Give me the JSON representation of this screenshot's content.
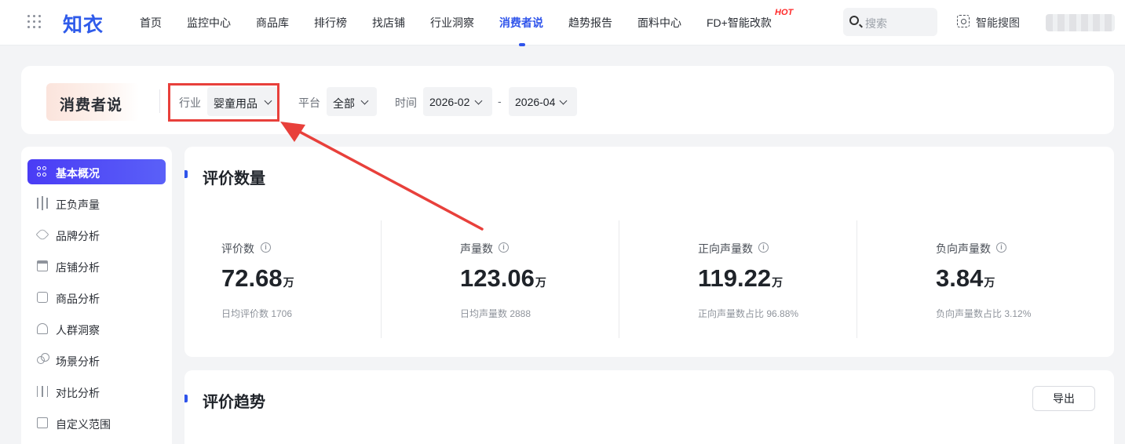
{
  "nav": {
    "logo": "知衣",
    "items": [
      "首页",
      "监控中心",
      "商品库",
      "排行榜",
      "找店铺",
      "行业洞察",
      "消费者说",
      "趋势报告",
      "面料中心",
      "FD+智能改款"
    ],
    "active_index": 6,
    "hot_label": "HOT",
    "search_placeholder": "搜索",
    "image_search_label": "智能搜图"
  },
  "filter": {
    "page_badge": "消费者说",
    "industry_label": "行业",
    "industry_value": "婴童用品",
    "platform_label": "平台",
    "platform_value": "全部",
    "time_label": "时间",
    "time_start": "2026-02",
    "time_separator": "-",
    "time_end": "2026-04"
  },
  "sidebar": {
    "items": [
      {
        "label": "基本概况",
        "icon": "grid-icon",
        "active": true
      },
      {
        "label": "正负声量",
        "icon": "soundwave-icon"
      },
      {
        "label": "品牌分析",
        "icon": "tag-icon"
      },
      {
        "label": "店铺分析",
        "icon": "store-icon"
      },
      {
        "label": "商品分析",
        "icon": "product-icon"
      },
      {
        "label": "人群洞察",
        "icon": "people-icon"
      },
      {
        "label": "场景分析",
        "icon": "scene-icon"
      },
      {
        "label": "对比分析",
        "icon": "compare-icon"
      },
      {
        "label": "自定义范围",
        "icon": "custom-range-icon"
      }
    ]
  },
  "overview": {
    "title": "评价数量",
    "stats": [
      {
        "label": "评价数",
        "value": "72.68",
        "unit": "万",
        "sub": "日均评价数 1706"
      },
      {
        "label": "声量数",
        "value": "123.06",
        "unit": "万",
        "sub": "日均声量数 2888"
      },
      {
        "label": "正向声量数",
        "value": "119.22",
        "unit": "万",
        "sub": "正向声量数占比 96.88%"
      },
      {
        "label": "负向声量数",
        "value": "3.84",
        "unit": "万",
        "sub": "负向声量数占比 3.12%"
      }
    ]
  },
  "trend": {
    "title": "评价趋势",
    "export_label": "导出"
  },
  "colors": {
    "accent": "#2f54eb",
    "annotation": "#e8403b",
    "hot": "#ff2a2a"
  }
}
